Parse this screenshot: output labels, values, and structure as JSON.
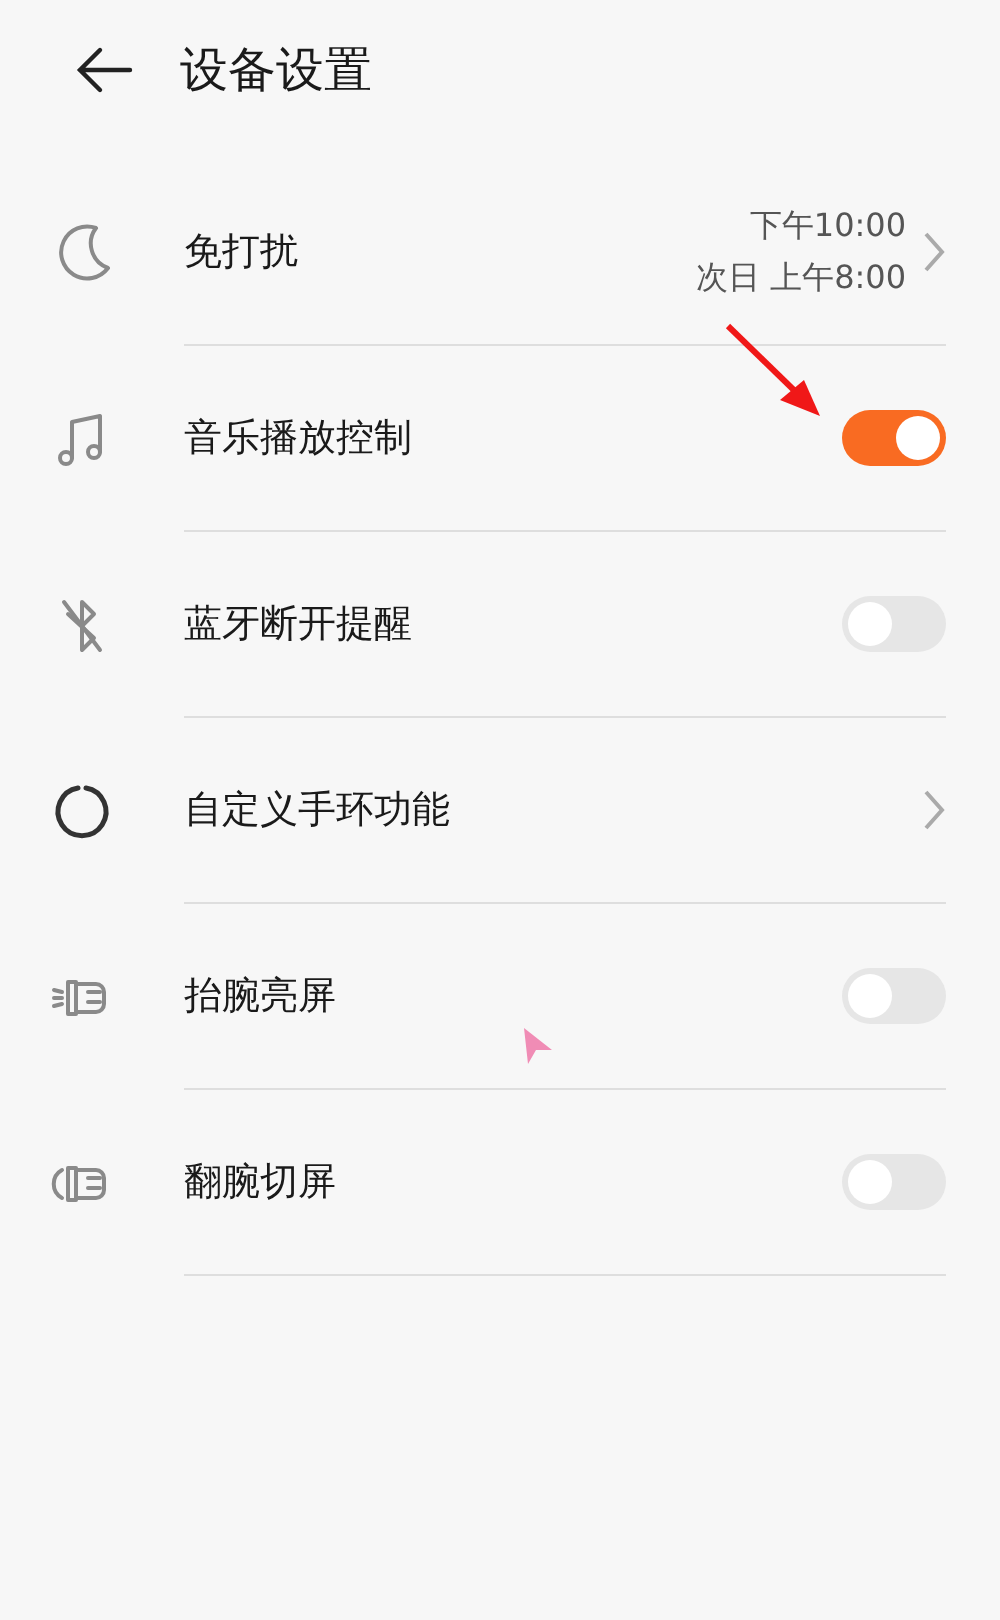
{
  "header": {
    "title": "设备设置"
  },
  "settings": [
    {
      "kind": "chevron",
      "label": "免打扰",
      "detail": [
        "下午10:00",
        "次日 上午8:00"
      ]
    },
    {
      "kind": "switch",
      "label": "音乐播放控制",
      "on": true
    },
    {
      "kind": "switch",
      "label": "蓝牙断开提醒",
      "on": false
    },
    {
      "kind": "chevron",
      "label": "自定义手环功能"
    },
    {
      "kind": "switch",
      "label": "抬腕亮屏",
      "on": false
    },
    {
      "kind": "switch",
      "label": "翻腕切屏",
      "on": false
    }
  ]
}
